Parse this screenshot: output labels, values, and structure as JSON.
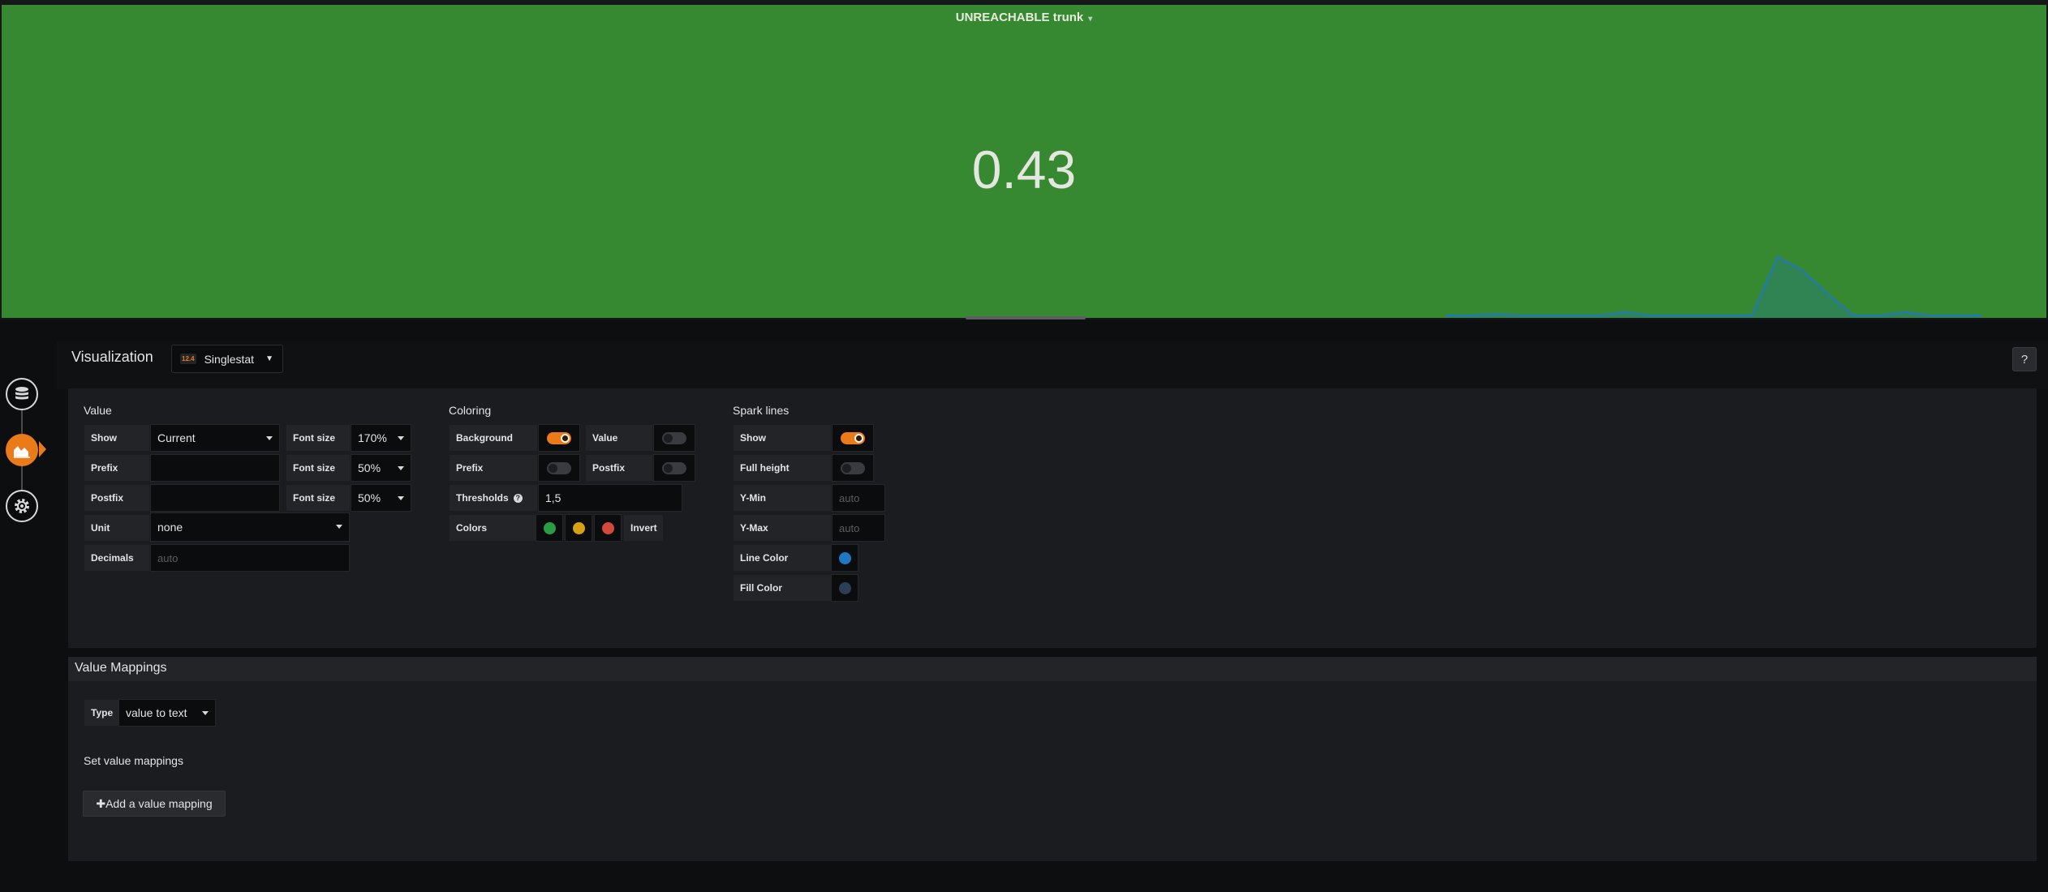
{
  "panel": {
    "title": "UNREACHABLE trunk",
    "value": "0.43",
    "background_color": "#368930",
    "sparkline": {
      "line_color": "#1F78C1",
      "points": [
        0,
        0,
        0.02,
        0,
        0,
        0,
        0,
        0.05,
        0,
        0,
        0,
        0,
        0,
        0.85,
        0.65,
        0.3,
        0,
        0,
        0.05,
        0,
        0,
        0
      ]
    }
  },
  "rail": {
    "items": [
      {
        "name": "queries",
        "icon": "database-icon"
      },
      {
        "name": "visualization",
        "icon": "chart-icon",
        "active": true
      },
      {
        "name": "general",
        "icon": "gear-icon"
      }
    ]
  },
  "editor": {
    "title": "Visualization",
    "viz_picker": {
      "icon_text": "12.4",
      "label": "Singlestat"
    },
    "help": "?"
  },
  "value_section": {
    "title": "Value",
    "show_label": "Show",
    "show_value": "Current",
    "font_size_label": "Font size",
    "font_size_1": "170%",
    "font_size_2": "50%",
    "font_size_3": "50%",
    "prefix_label": "Prefix",
    "postfix_label": "Postfix",
    "unit_label": "Unit",
    "unit_value": "none",
    "decimals_label": "Decimals",
    "decimals_placeholder": "auto"
  },
  "coloring_section": {
    "title": "Coloring",
    "background_label": "Background",
    "background_on": true,
    "value_label": "Value",
    "value_on": false,
    "prefix_label": "Prefix",
    "prefix_on": false,
    "postfix_label": "Postfix",
    "postfix_on": false,
    "thresholds_label": "Thresholds",
    "thresholds_value": "1,5",
    "colors_label": "Colors",
    "colors": [
      "#299c46",
      "#d8a013",
      "#d44a3a"
    ],
    "invert_label": "Invert"
  },
  "spark_section": {
    "title": "Spark lines",
    "show_label": "Show",
    "show_on": true,
    "full_height_label": "Full height",
    "full_height_on": false,
    "ymin_label": "Y-Min",
    "ymin_placeholder": "auto",
    "ymax_label": "Y-Max",
    "ymax_placeholder": "auto",
    "line_color_label": "Line Color",
    "line_color": "#1F78C1",
    "fill_color_label": "Fill Color",
    "fill_color": "#2c3f55"
  },
  "value_mappings": {
    "title": "Value Mappings",
    "type_label": "Type",
    "type_value": "value to text",
    "set_label": "Set value mappings",
    "add_button": "✚Add a value mapping"
  }
}
